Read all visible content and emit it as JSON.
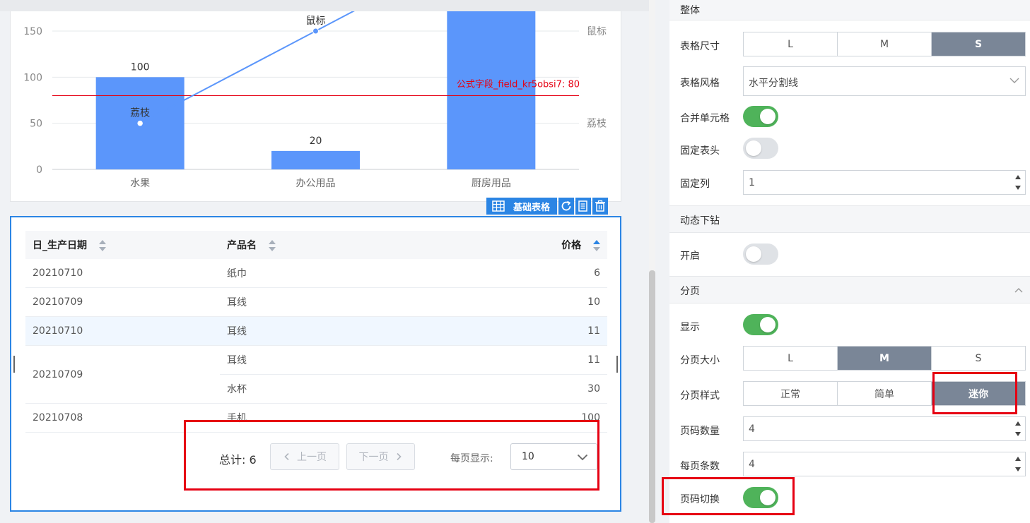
{
  "chart_data": {
    "type": "bar",
    "categories": [
      "水果",
      "办公用品",
      "厨房用品"
    ],
    "series": [
      {
        "name": "荔枝",
        "type": "bar",
        "values": [
          100,
          20,
          200
        ]
      },
      {
        "name": "鼠标",
        "type": "line",
        "values": [
          50,
          150,
          250
        ]
      }
    ],
    "data_labels": [
      "100",
      "20"
    ],
    "point_labels": [
      "荔枝",
      "鼠标"
    ],
    "yticks": [
      0,
      50,
      100,
      150
    ],
    "ylim": [
      0,
      175
    ],
    "reference_line": {
      "value": 80,
      "label": "公式字段_field_kr5obsi7: 80",
      "color": "#e60012"
    },
    "right_axis_labels": [
      {
        "text": "鼠标",
        "value": 150
      },
      {
        "text": "荔枝",
        "value": 50
      }
    ],
    "bar_color": "#5b96fb",
    "line_color": "#5b96fb",
    "grid": true
  },
  "table_toolbar": {
    "type_label": "基础表格",
    "icons": [
      "table-icon",
      "refresh-icon",
      "copy-icon",
      "trash-icon"
    ]
  },
  "table": {
    "headers": {
      "date": "日_生产日期",
      "product": "产品名",
      "price": "价格"
    },
    "rows": [
      {
        "date": "20210710",
        "product": "纸巾",
        "price": "6"
      },
      {
        "date": "20210709",
        "product": "耳线",
        "price": "10"
      },
      {
        "date": "20210710",
        "product": "耳线",
        "price": "11"
      },
      {
        "date": "20210709",
        "product": "耳线",
        "price": "11"
      },
      {
        "product": "水杯",
        "price": "30"
      },
      {
        "date": "20210708",
        "product": "手机",
        "price": "100"
      }
    ]
  },
  "pager": {
    "total": "总计: 6",
    "prev": "上一页",
    "next": "下一页",
    "per_page_label": "每页显示:",
    "per_page_value": "10"
  },
  "panel": {
    "sec_overall": "整体",
    "table_size_label": "表格尺寸",
    "table_size_options": [
      "L",
      "M",
      "S"
    ],
    "table_style_label": "表格风格",
    "table_style_value": "水平分割线",
    "merge_cells_label": "合并单元格",
    "fixed_header_label": "固定表头",
    "fixed_cols_label": "固定列",
    "fixed_cols_value": "1",
    "sec_drill": "动态下钻",
    "drill_on_label": "开启",
    "sec_paging": "分页",
    "show_label": "显示",
    "page_size_label": "分页大小",
    "page_size_options": [
      "L",
      "M",
      "S"
    ],
    "page_style_label": "分页样式",
    "page_style_options": [
      "正常",
      "简单",
      "迷你"
    ],
    "page_count_label": "页码数量",
    "page_count_value": "4",
    "per_page_label": "每页条数",
    "per_page_value": "4",
    "page_switch_label": "页码切换"
  },
  "colors": {
    "accent": "#2b85e4",
    "toggle_on": "#4fb35a",
    "highlight_red": "#e60012",
    "segment_active": "#7a8697"
  }
}
